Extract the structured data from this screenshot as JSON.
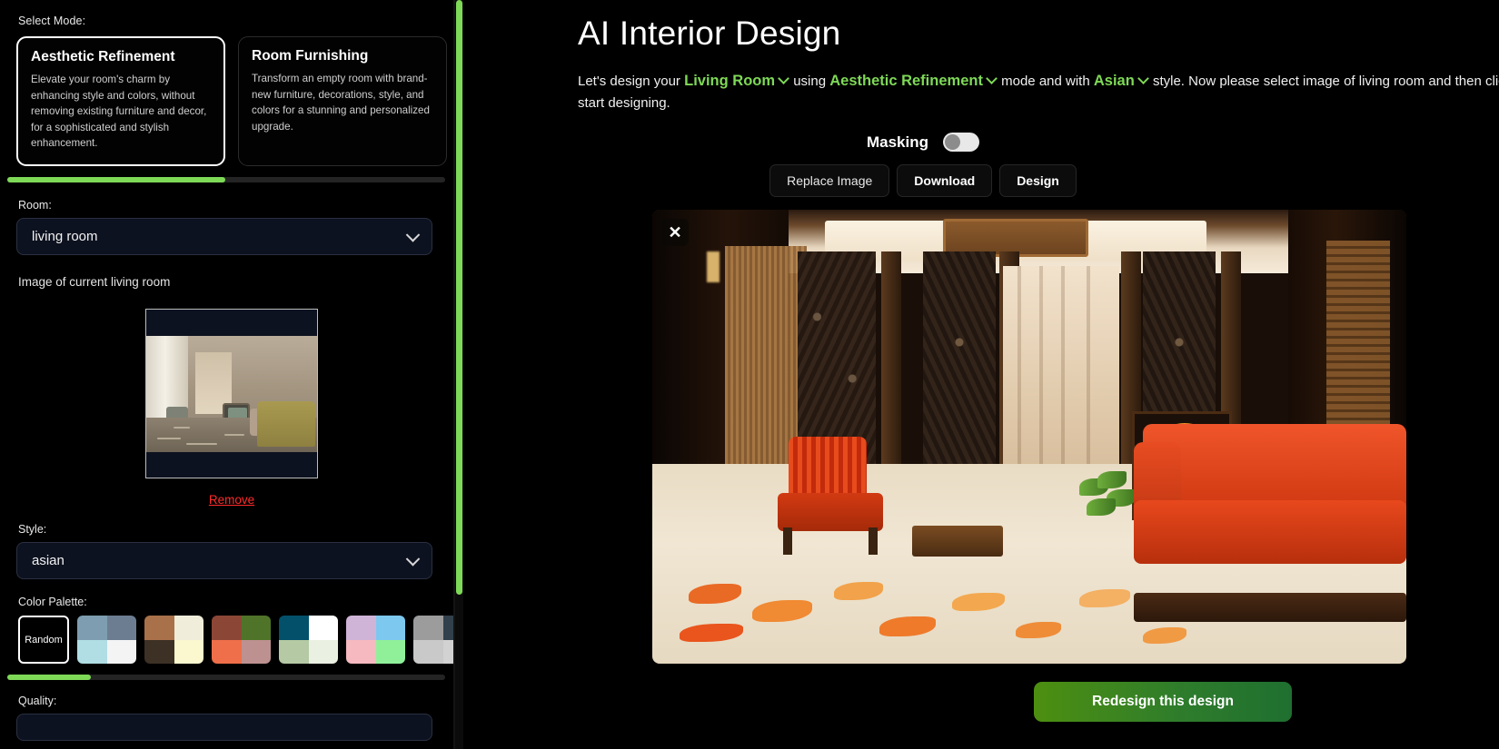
{
  "sidebar": {
    "select_mode_label": "Select Mode:",
    "modes": [
      {
        "title": "Aesthetic Refinement",
        "desc": "Elevate your room's charm by enhancing style and colors, without removing existing furniture and decor, for a sophisticated and stylish enhancement.",
        "selected": true
      },
      {
        "title": "Room Furnishing",
        "desc": "Transform an empty room with brand-new furniture, decorations, style, and colors for a stunning and personalized upgrade.",
        "selected": false
      }
    ],
    "room_label": "Room:",
    "room_value": "living room",
    "image_caption": "Image of current living room",
    "remove_label": "Remove",
    "style_label": "Style:",
    "style_value": "asian",
    "palette_label": "Color Palette:",
    "palette_random_label": "Random",
    "palettes": [
      [
        "#7e9db0",
        "#6c7d92",
        "#b0dee4",
        "#f4f4f4"
      ],
      [
        "#a9714a",
        "#f0eddb",
        "#3d3125",
        "#fbf7cf"
      ],
      [
        "#8c4636",
        "#4f7429",
        "#ee6f49",
        "#bd9190"
      ],
      [
        "#03506b",
        "#ffffff",
        "#b5c9a4",
        "#eaf0e2"
      ],
      [
        "#cfb4d8",
        "#7cc8ef",
        "#f6b9bf",
        "#90f09a"
      ],
      [
        "#9c9c9c",
        "#32404c",
        "#c9c9c9",
        "#d2d2d2"
      ],
      [
        "#fbf3c4",
        "#fbf3c4",
        "#f9a000",
        "#f9a000"
      ]
    ],
    "quality_label": "Quality:"
  },
  "main": {
    "title": "AI Interior Design",
    "subtitle_part1": "Let's design your",
    "subtitle_room": "Living Room",
    "subtitle_part2": "using",
    "subtitle_mode": "Aesthetic Refinement",
    "subtitle_part3": "mode and with",
    "subtitle_style": "Asian",
    "subtitle_part4": "style. Now please select image of living room and then click on start designing.",
    "masking_label": "Masking",
    "masking_on": false,
    "buttons": {
      "replace_image": "Replace Image",
      "download": "Download",
      "design": "Design"
    },
    "close_icon": "✕",
    "redesign_label": "Redesign this design"
  },
  "colors": {
    "accent_green": "#7ed957",
    "remove_red": "#ff2b2b",
    "button_green_start": "#4d8f10",
    "button_green_end": "#1f6f30"
  }
}
